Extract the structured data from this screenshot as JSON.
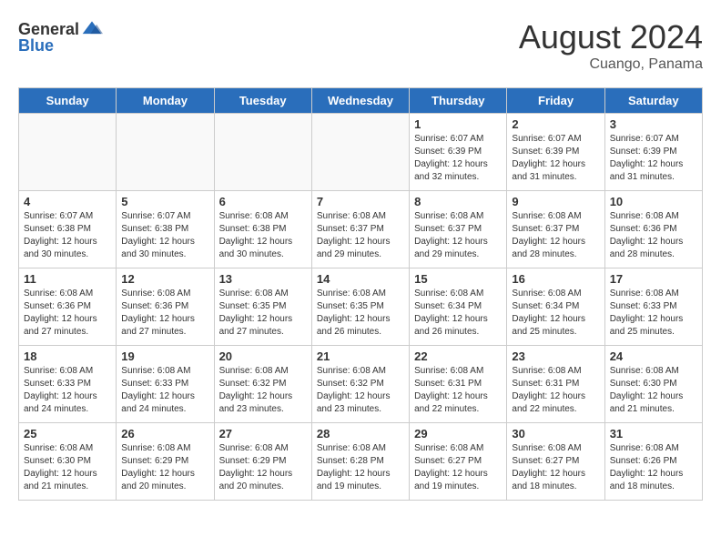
{
  "header": {
    "logo_general": "General",
    "logo_blue": "Blue",
    "month_title": "August 2024",
    "location": "Cuango, Panama"
  },
  "weekdays": [
    "Sunday",
    "Monday",
    "Tuesday",
    "Wednesday",
    "Thursday",
    "Friday",
    "Saturday"
  ],
  "weeks": [
    [
      {
        "day": "",
        "info": "",
        "empty": true
      },
      {
        "day": "",
        "info": "",
        "empty": true
      },
      {
        "day": "",
        "info": "",
        "empty": true
      },
      {
        "day": "",
        "info": "",
        "empty": true
      },
      {
        "day": "1",
        "info": "Sunrise: 6:07 AM\nSunset: 6:39 PM\nDaylight: 12 hours\nand 32 minutes.",
        "empty": false
      },
      {
        "day": "2",
        "info": "Sunrise: 6:07 AM\nSunset: 6:39 PM\nDaylight: 12 hours\nand 31 minutes.",
        "empty": false
      },
      {
        "day": "3",
        "info": "Sunrise: 6:07 AM\nSunset: 6:39 PM\nDaylight: 12 hours\nand 31 minutes.",
        "empty": false
      }
    ],
    [
      {
        "day": "4",
        "info": "Sunrise: 6:07 AM\nSunset: 6:38 PM\nDaylight: 12 hours\nand 30 minutes.",
        "empty": false
      },
      {
        "day": "5",
        "info": "Sunrise: 6:07 AM\nSunset: 6:38 PM\nDaylight: 12 hours\nand 30 minutes.",
        "empty": false
      },
      {
        "day": "6",
        "info": "Sunrise: 6:08 AM\nSunset: 6:38 PM\nDaylight: 12 hours\nand 30 minutes.",
        "empty": false
      },
      {
        "day": "7",
        "info": "Sunrise: 6:08 AM\nSunset: 6:37 PM\nDaylight: 12 hours\nand 29 minutes.",
        "empty": false
      },
      {
        "day": "8",
        "info": "Sunrise: 6:08 AM\nSunset: 6:37 PM\nDaylight: 12 hours\nand 29 minutes.",
        "empty": false
      },
      {
        "day": "9",
        "info": "Sunrise: 6:08 AM\nSunset: 6:37 PM\nDaylight: 12 hours\nand 28 minutes.",
        "empty": false
      },
      {
        "day": "10",
        "info": "Sunrise: 6:08 AM\nSunset: 6:36 PM\nDaylight: 12 hours\nand 28 minutes.",
        "empty": false
      }
    ],
    [
      {
        "day": "11",
        "info": "Sunrise: 6:08 AM\nSunset: 6:36 PM\nDaylight: 12 hours\nand 27 minutes.",
        "empty": false
      },
      {
        "day": "12",
        "info": "Sunrise: 6:08 AM\nSunset: 6:36 PM\nDaylight: 12 hours\nand 27 minutes.",
        "empty": false
      },
      {
        "day": "13",
        "info": "Sunrise: 6:08 AM\nSunset: 6:35 PM\nDaylight: 12 hours\nand 27 minutes.",
        "empty": false
      },
      {
        "day": "14",
        "info": "Sunrise: 6:08 AM\nSunset: 6:35 PM\nDaylight: 12 hours\nand 26 minutes.",
        "empty": false
      },
      {
        "day": "15",
        "info": "Sunrise: 6:08 AM\nSunset: 6:34 PM\nDaylight: 12 hours\nand 26 minutes.",
        "empty": false
      },
      {
        "day": "16",
        "info": "Sunrise: 6:08 AM\nSunset: 6:34 PM\nDaylight: 12 hours\nand 25 minutes.",
        "empty": false
      },
      {
        "day": "17",
        "info": "Sunrise: 6:08 AM\nSunset: 6:33 PM\nDaylight: 12 hours\nand 25 minutes.",
        "empty": false
      }
    ],
    [
      {
        "day": "18",
        "info": "Sunrise: 6:08 AM\nSunset: 6:33 PM\nDaylight: 12 hours\nand 24 minutes.",
        "empty": false
      },
      {
        "day": "19",
        "info": "Sunrise: 6:08 AM\nSunset: 6:33 PM\nDaylight: 12 hours\nand 24 minutes.",
        "empty": false
      },
      {
        "day": "20",
        "info": "Sunrise: 6:08 AM\nSunset: 6:32 PM\nDaylight: 12 hours\nand 23 minutes.",
        "empty": false
      },
      {
        "day": "21",
        "info": "Sunrise: 6:08 AM\nSunset: 6:32 PM\nDaylight: 12 hours\nand 23 minutes.",
        "empty": false
      },
      {
        "day": "22",
        "info": "Sunrise: 6:08 AM\nSunset: 6:31 PM\nDaylight: 12 hours\nand 22 minutes.",
        "empty": false
      },
      {
        "day": "23",
        "info": "Sunrise: 6:08 AM\nSunset: 6:31 PM\nDaylight: 12 hours\nand 22 minutes.",
        "empty": false
      },
      {
        "day": "24",
        "info": "Sunrise: 6:08 AM\nSunset: 6:30 PM\nDaylight: 12 hours\nand 21 minutes.",
        "empty": false
      }
    ],
    [
      {
        "day": "25",
        "info": "Sunrise: 6:08 AM\nSunset: 6:30 PM\nDaylight: 12 hours\nand 21 minutes.",
        "empty": false
      },
      {
        "day": "26",
        "info": "Sunrise: 6:08 AM\nSunset: 6:29 PM\nDaylight: 12 hours\nand 20 minutes.",
        "empty": false
      },
      {
        "day": "27",
        "info": "Sunrise: 6:08 AM\nSunset: 6:29 PM\nDaylight: 12 hours\nand 20 minutes.",
        "empty": false
      },
      {
        "day": "28",
        "info": "Sunrise: 6:08 AM\nSunset: 6:28 PM\nDaylight: 12 hours\nand 19 minutes.",
        "empty": false
      },
      {
        "day": "29",
        "info": "Sunrise: 6:08 AM\nSunset: 6:27 PM\nDaylight: 12 hours\nand 19 minutes.",
        "empty": false
      },
      {
        "day": "30",
        "info": "Sunrise: 6:08 AM\nSunset: 6:27 PM\nDaylight: 12 hours\nand 18 minutes.",
        "empty": false
      },
      {
        "day": "31",
        "info": "Sunrise: 6:08 AM\nSunset: 6:26 PM\nDaylight: 12 hours\nand 18 minutes.",
        "empty": false
      }
    ]
  ]
}
